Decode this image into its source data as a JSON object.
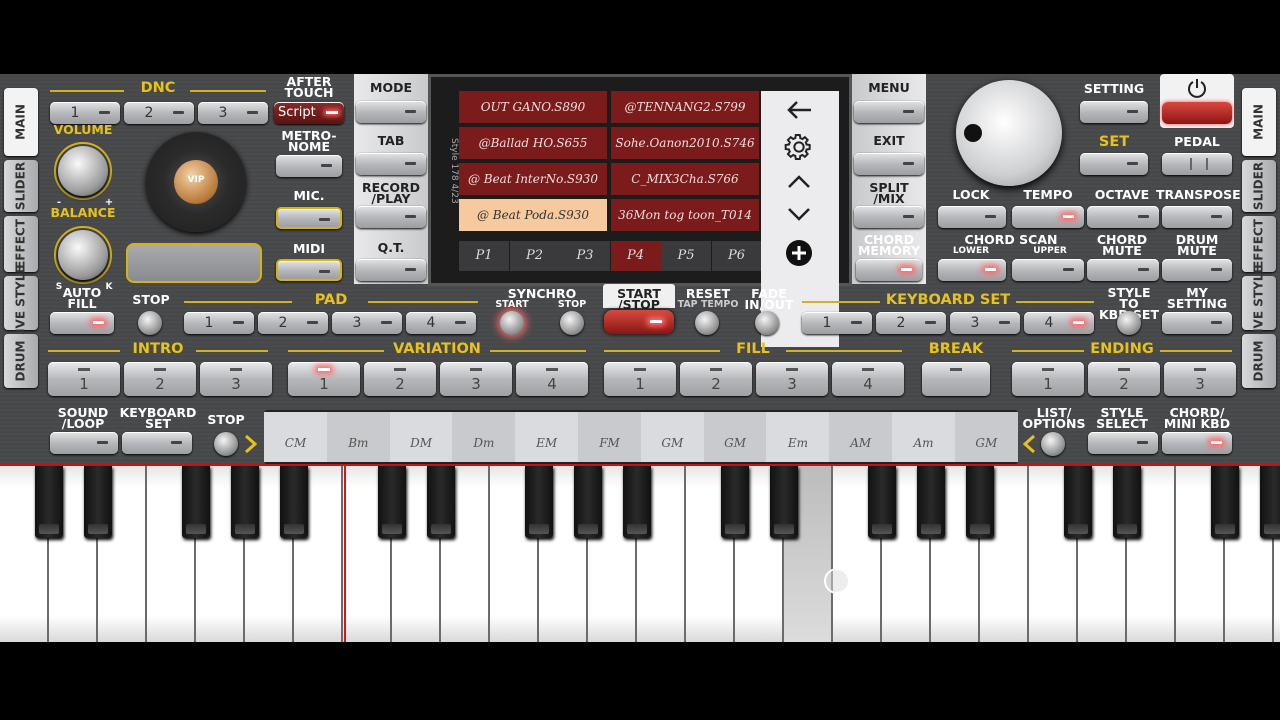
{
  "app": {
    "accent": "#e8c21c",
    "led": "#ff5a5a",
    "screen_bg": "#7b1b1c"
  },
  "side_tabs_left": [
    "MAIN",
    "SLIDER",
    "EFFECT",
    "LIVE\nSTYLE",
    "DRUM"
  ],
  "side_tabs_right": [
    "MAIN",
    "SLIDER",
    "EFFECT",
    "LIVE\nSTYLE",
    "DRUM"
  ],
  "dnc": {
    "label": "DNC",
    "buttons": [
      "1",
      "2",
      "3"
    ],
    "script": "Script"
  },
  "after_touch": "AFTER\nTOUCH",
  "volume": "VOLUME",
  "balance": "BALANCE",
  "balance_s": "S",
  "balance_k": "K",
  "vol_minus": "-",
  "vol_plus": "+",
  "vip": "VIP",
  "metronome": "METRO-\nNOME",
  "mic": "MIC.",
  "midi": "MIDI",
  "mode": "MODE",
  "tab": "TAB",
  "record_play": "RECORD\n/PLAY",
  "qt": "Q.T.",
  "screen": {
    "side_label": "Style 178 4/23",
    "songs": [
      "OUT GANO.S890",
      "@TENNANG2.S799",
      "@Ballad HO.S655",
      "Sohe.Oanon2010.S746",
      "@ Beat InterNo.S930",
      "C_MIX3Cha.S766",
      "@ Beat Poda.S930",
      "36Mon tog toon_T014"
    ],
    "selected": 6,
    "pages": [
      "P1",
      "P2",
      "P3",
      "P4",
      "P5",
      "P6"
    ],
    "active_page": 3,
    "nav_icons": [
      "back-arrow-icon",
      "gear-icon",
      "chevron-up-icon",
      "chevron-down-icon",
      "plus-circle-icon"
    ]
  },
  "menu": "MENU",
  "exit": "EXIT",
  "split_mix": "SPLIT\n/MIX",
  "chord_memory": "CHORD\nMEMORY",
  "setting": "SETTING",
  "set": "SET",
  "pedal": "PEDAL",
  "power_icon": "power-icon",
  "lock": "LOCK",
  "tempo": "TEMPO",
  "octave": "OCTAVE",
  "transpose": "TRANSPOSE",
  "chord_scan": "CHORD SCAN",
  "lower": "LOWER",
  "upper": "UPPER",
  "chord_mute": "CHORD\nMUTE",
  "drum_mute": "DRUM\nMUTE",
  "auto_fill": "AUTO\nFILL",
  "stop": "STOP",
  "pad": {
    "label": "PAD",
    "buttons": [
      "1",
      "2",
      "3",
      "4"
    ]
  },
  "synchro": "SYNCHRO",
  "synchro_start": "START",
  "synchro_stop": "STOP",
  "start_stop": "START\n/STOP",
  "reset": "RESET",
  "tap_tempo": "TAP TEMPO",
  "fade": "FADE\nIN/OUT",
  "keyboard_set": {
    "label": "KEYBOARD SET",
    "buttons": [
      "1",
      "2",
      "3",
      "4"
    ]
  },
  "style_to_kbd": "STYLE TO\nKBD SET",
  "my_setting": "MY\nSETTING",
  "intro": {
    "label": "INTRO",
    "buttons": [
      "1",
      "2",
      "3"
    ]
  },
  "variation": {
    "label": "VARIATION",
    "buttons": [
      "1",
      "2",
      "3",
      "4"
    ]
  },
  "fill": {
    "label": "FILL",
    "buttons": [
      "1",
      "2",
      "3",
      "4"
    ]
  },
  "break": "BREAK",
  "ending": {
    "label": "ENDING",
    "buttons": [
      "1",
      "2",
      "3"
    ]
  },
  "sound_loop": "SOUND\n/LOOP",
  "keyboard_set_btn": "KEYBOARD\nSET",
  "stop2": "STOP",
  "chords": [
    "CM",
    "Bm",
    "DM",
    "Dm",
    "EM",
    "FM",
    "GM",
    "GM",
    "Em",
    "AM",
    "Am",
    "GM"
  ],
  "list_options": "LIST/\nOPTIONS",
  "style_select": "STYLE\nSELECT",
  "chord_mini": "CHORD/\nMINI KBD"
}
